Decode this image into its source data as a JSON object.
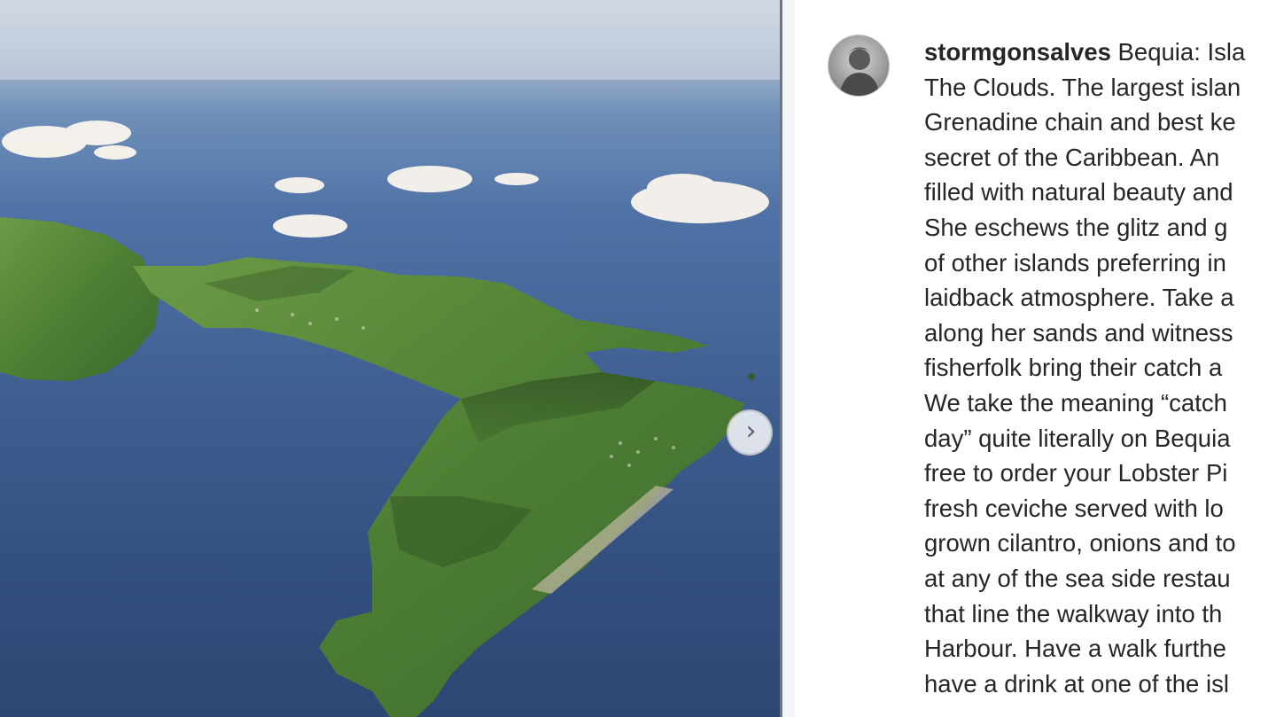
{
  "post": {
    "image_alt": "Aerial view of Bequia island",
    "next_label": "›"
  },
  "caption": {
    "username": "stormgonsalves",
    "first_line_text": " Bequia: Isla",
    "lines": [
      "The Clouds. The largest islan",
      "Grenadine chain and best ke",
      "secret of the Caribbean. An",
      "filled with natural beauty and",
      "She eschews the glitz and g",
      "of other islands preferring in",
      "laidback atmosphere. Take a",
      "along her sands and witness",
      "fisherfolk bring their catch a",
      "We take the meaning “catch",
      "day” quite literally on Bequia",
      "free to order your Lobster Pi",
      "fresh ceviche served with lo",
      "grown cilantro, onions and to",
      "at any of the sea side restau",
      "that line the walkway into th",
      "Harbour. Have a walk furthe",
      "have a drink at one of the isl"
    ]
  },
  "colors": {
    "sea": "#3f5f92",
    "land": "#5b8a3a",
    "text": "#262626"
  }
}
